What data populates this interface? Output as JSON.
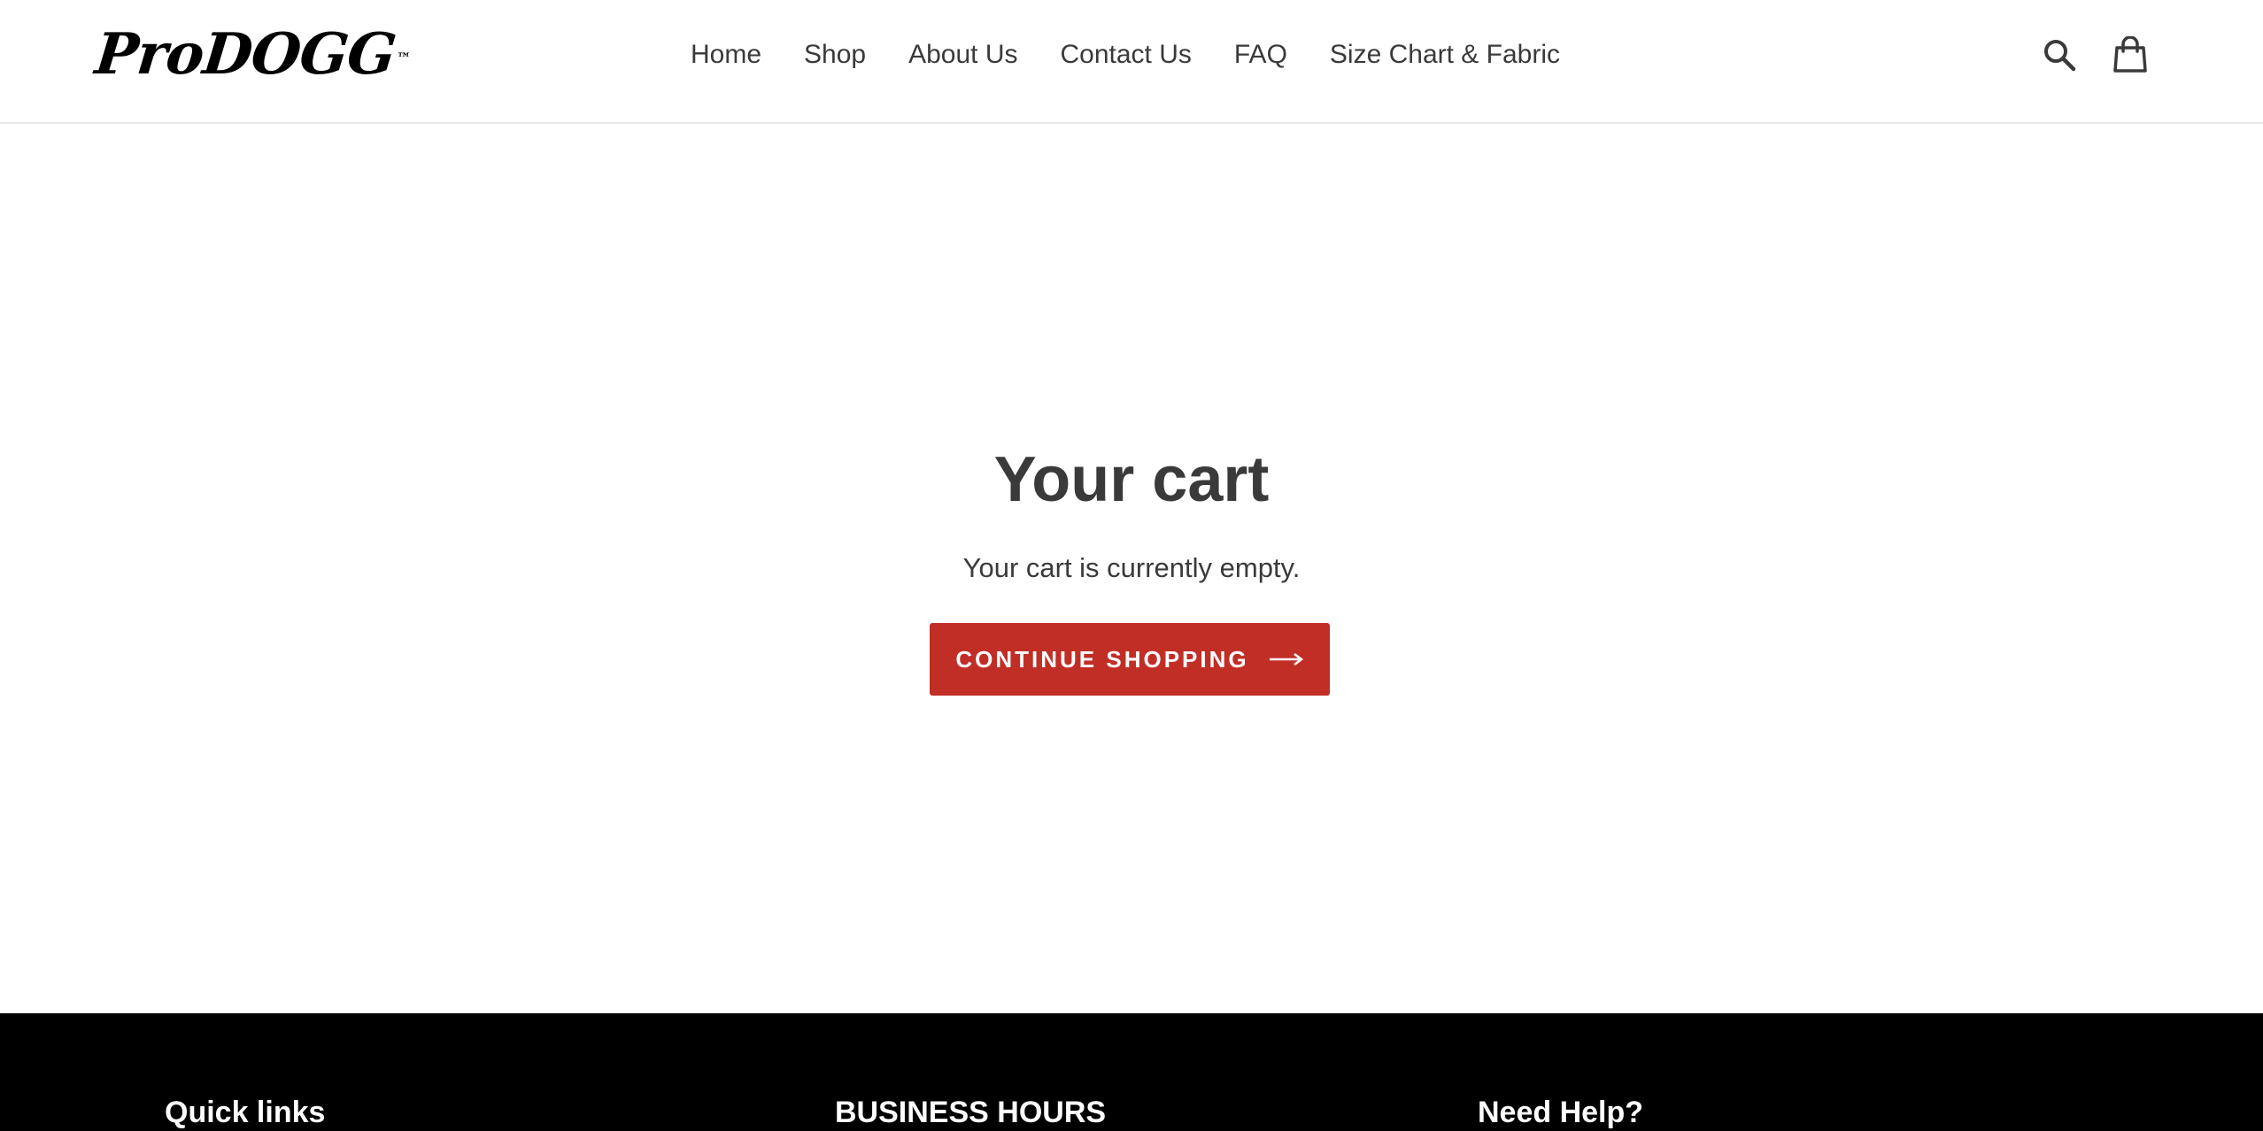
{
  "header": {
    "logo_text_main": "ProDOGG",
    "logo_tm": "™",
    "nav": [
      {
        "label": "Home"
      },
      {
        "label": "Shop"
      },
      {
        "label": "About Us"
      },
      {
        "label": "Contact Us"
      },
      {
        "label": "FAQ"
      },
      {
        "label": "Size Chart & Fabric"
      }
    ],
    "icons": {
      "search": "search-icon",
      "cart": "shopping-bag-icon"
    }
  },
  "main": {
    "title": "Your cart",
    "empty_message": "Your cart is currently empty.",
    "continue_button": {
      "label": "CONTINUE SHOPPING",
      "icon": "arrow-right-icon"
    }
  },
  "footer": {
    "headings": [
      "Quick links",
      "BUSINESS HOURS",
      "Need Help?"
    ]
  },
  "colors": {
    "accent": "#c12e26",
    "text": "#3a3a3a",
    "footer_bg": "#000000",
    "background": "#ffffff"
  }
}
